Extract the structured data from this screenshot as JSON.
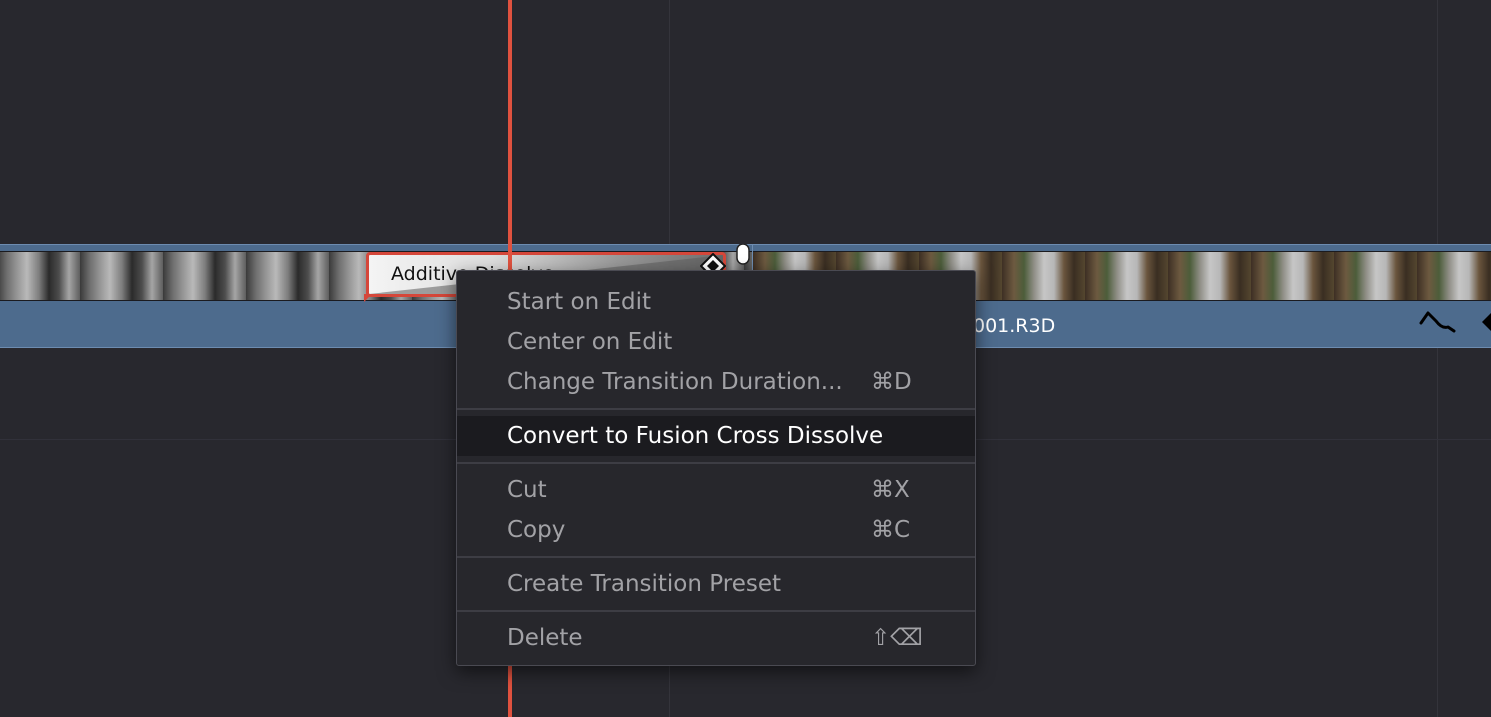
{
  "timeline": {
    "right_clip_name": "001.R3D"
  },
  "transition": {
    "label": "Additive Dissolve"
  },
  "context_menu": {
    "items": [
      {
        "label": "Start on Edit",
        "shortcut": "",
        "enabled": false
      },
      {
        "label": "Center on Edit",
        "shortcut": "",
        "enabled": false
      },
      {
        "label": "Change Transition Duration...",
        "shortcut": "⌘D",
        "enabled": false
      },
      {
        "label": "Convert to Fusion Cross Dissolve",
        "shortcut": "",
        "enabled": true,
        "highlighted": true
      },
      {
        "label": "Cut",
        "shortcut": "⌘X",
        "enabled": false
      },
      {
        "label": "Copy",
        "shortcut": "⌘C",
        "enabled": false
      },
      {
        "label": "Create Transition Preset",
        "shortcut": "",
        "enabled": false
      },
      {
        "label": "Delete",
        "shortcut": "⇧⌫",
        "enabled": false
      }
    ]
  },
  "colors": {
    "background": "#28282e",
    "clip_blue": "#4d6b8d",
    "playhead_red": "#e0523f",
    "menu_background": "#27272c",
    "menu_text_disabled": "#a2a2a6",
    "menu_text_active": "#ffffff"
  },
  "icons": [
    "keyframe-curve-icon",
    "keyframe-diamond-icon",
    "transition-end-diamond-icon",
    "edit-point-handle-icon"
  ]
}
